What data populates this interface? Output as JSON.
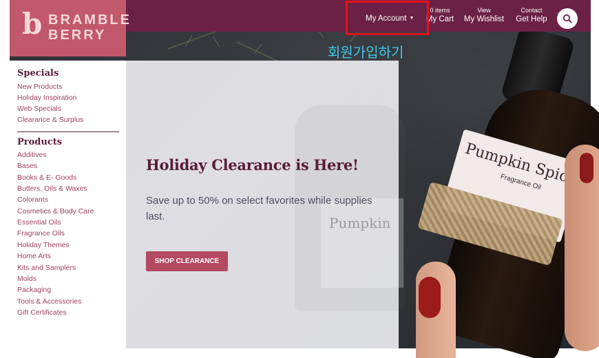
{
  "brand": {
    "logo_glyph": "b",
    "name_line1": "BRAMBLE",
    "name_line2": "BERRY"
  },
  "nav": {
    "my_account": "My Account",
    "cart_count": "0 items",
    "cart_label": "My Cart",
    "wishlist_top": "View",
    "wishlist_label": "My Wishlist",
    "help_top": "Contact",
    "help_label": "Get Help"
  },
  "annotation": {
    "caption": "회원가입하기"
  },
  "sidebar": {
    "specials_heading": "Specials",
    "specials": [
      {
        "label": "New Products"
      },
      {
        "label": "Holiday Inspiration"
      },
      {
        "label": "Web Specials"
      },
      {
        "label": "Clearance & Surplus"
      }
    ],
    "products_heading": "Products",
    "products": [
      {
        "label": "Additives"
      },
      {
        "label": "Bases"
      },
      {
        "label": "Books & E- Goods"
      },
      {
        "label": "Butters, Oils & Waxes"
      },
      {
        "label": "Colorants"
      },
      {
        "label": "Cosmetics & Body Care"
      },
      {
        "label": "Essential Oils"
      },
      {
        "label": "Fragrance Oils"
      },
      {
        "label": "Holiday Themes"
      },
      {
        "label": "Home Arts"
      },
      {
        "label": "Kits and Samplers"
      },
      {
        "label": "Molds"
      },
      {
        "label": "Packaging"
      },
      {
        "label": "Tools & Accessories"
      },
      {
        "label": "Gift Certificates"
      }
    ]
  },
  "promo": {
    "title": "Holiday Clearance is Here!",
    "body": "Save up to 50% on select favorites while supplies last.",
    "button": "SHOP CLEARANCE"
  },
  "hero": {
    "bottle_title": "Pumpkin Spice",
    "bottle_subtitle": "Fragrance Oil",
    "ghost_text": "Pumpkin"
  },
  "colors": {
    "navbar": "#6b2145",
    "logo_bg": "#c2586b",
    "accent_button": "#b34a62",
    "heading": "#5a1c38",
    "link": "#a04060",
    "highlight_box": "#e3111b",
    "caption": "#3ec8e9"
  }
}
